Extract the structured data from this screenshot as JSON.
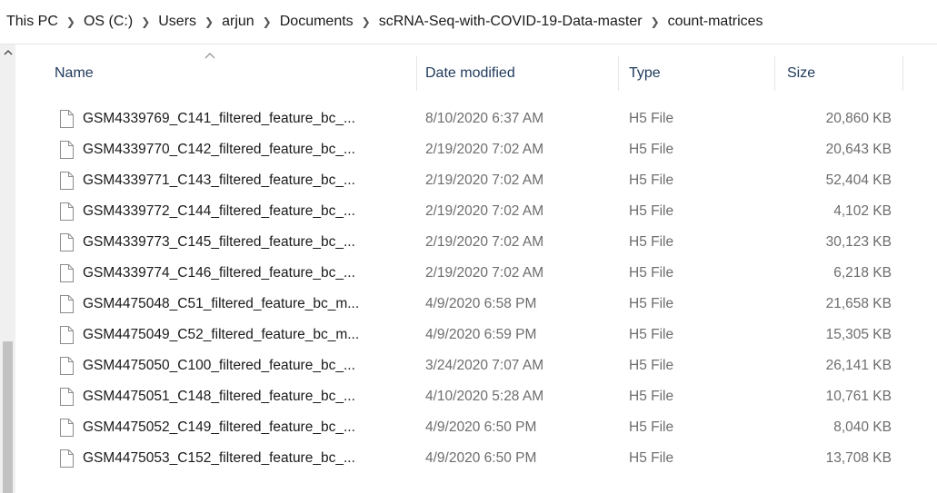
{
  "breadcrumb": {
    "items": [
      "This PC",
      "OS (C:)",
      "Users",
      "arjun",
      "Documents",
      "scRNA-Seq-with-COVID-19-Data-master",
      "count-matrices"
    ],
    "separator_icon": "chevron-right-icon"
  },
  "columns": {
    "name": "Name",
    "date_modified": "Date modified",
    "type": "Type",
    "size": "Size"
  },
  "sort": {
    "column": "Name",
    "direction": "ascending",
    "icon": "chevron-up-icon"
  },
  "files": [
    {
      "name": "GSM4339769_C141_filtered_feature_bc_...",
      "date": "8/10/2020 6:37 AM",
      "type": "H5 File",
      "size": "20,860 KB"
    },
    {
      "name": "GSM4339770_C142_filtered_feature_bc_...",
      "date": "2/19/2020 7:02 AM",
      "type": "H5 File",
      "size": "20,643 KB"
    },
    {
      "name": "GSM4339771_C143_filtered_feature_bc_...",
      "date": "2/19/2020 7:02 AM",
      "type": "H5 File",
      "size": "52,404 KB"
    },
    {
      "name": "GSM4339772_C144_filtered_feature_bc_...",
      "date": "2/19/2020 7:02 AM",
      "type": "H5 File",
      "size": "4,102 KB"
    },
    {
      "name": "GSM4339773_C145_filtered_feature_bc_...",
      "date": "2/19/2020 7:02 AM",
      "type": "H5 File",
      "size": "30,123 KB"
    },
    {
      "name": "GSM4339774_C146_filtered_feature_bc_...",
      "date": "2/19/2020 7:02 AM",
      "type": "H5 File",
      "size": "6,218 KB"
    },
    {
      "name": "GSM4475048_C51_filtered_feature_bc_m...",
      "date": "4/9/2020 6:58 PM",
      "type": "H5 File",
      "size": "21,658 KB"
    },
    {
      "name": "GSM4475049_C52_filtered_feature_bc_m...",
      "date": "4/9/2020 6:59 PM",
      "type": "H5 File",
      "size": "15,305 KB"
    },
    {
      "name": "GSM4475050_C100_filtered_feature_bc_...",
      "date": "3/24/2020 7:07 AM",
      "type": "H5 File",
      "size": "26,141 KB"
    },
    {
      "name": "GSM4475051_C148_filtered_feature_bc_...",
      "date": "4/10/2020 5:28 AM",
      "type": "H5 File",
      "size": "10,761 KB"
    },
    {
      "name": "GSM4475052_C149_filtered_feature_bc_...",
      "date": "4/9/2020 6:50 PM",
      "type": "H5 File",
      "size": "8,040 KB"
    },
    {
      "name": "GSM4475053_C152_filtered_feature_bc_...",
      "date": "4/9/2020 6:50 PM",
      "type": "H5 File",
      "size": "13,708 KB"
    }
  ],
  "colors": {
    "header_text": "#1e395b",
    "secondary_text": "#6d6d6d",
    "scrollbar_track": "#f0f0f0",
    "scrollbar_thumb": "#c2c2c2"
  }
}
